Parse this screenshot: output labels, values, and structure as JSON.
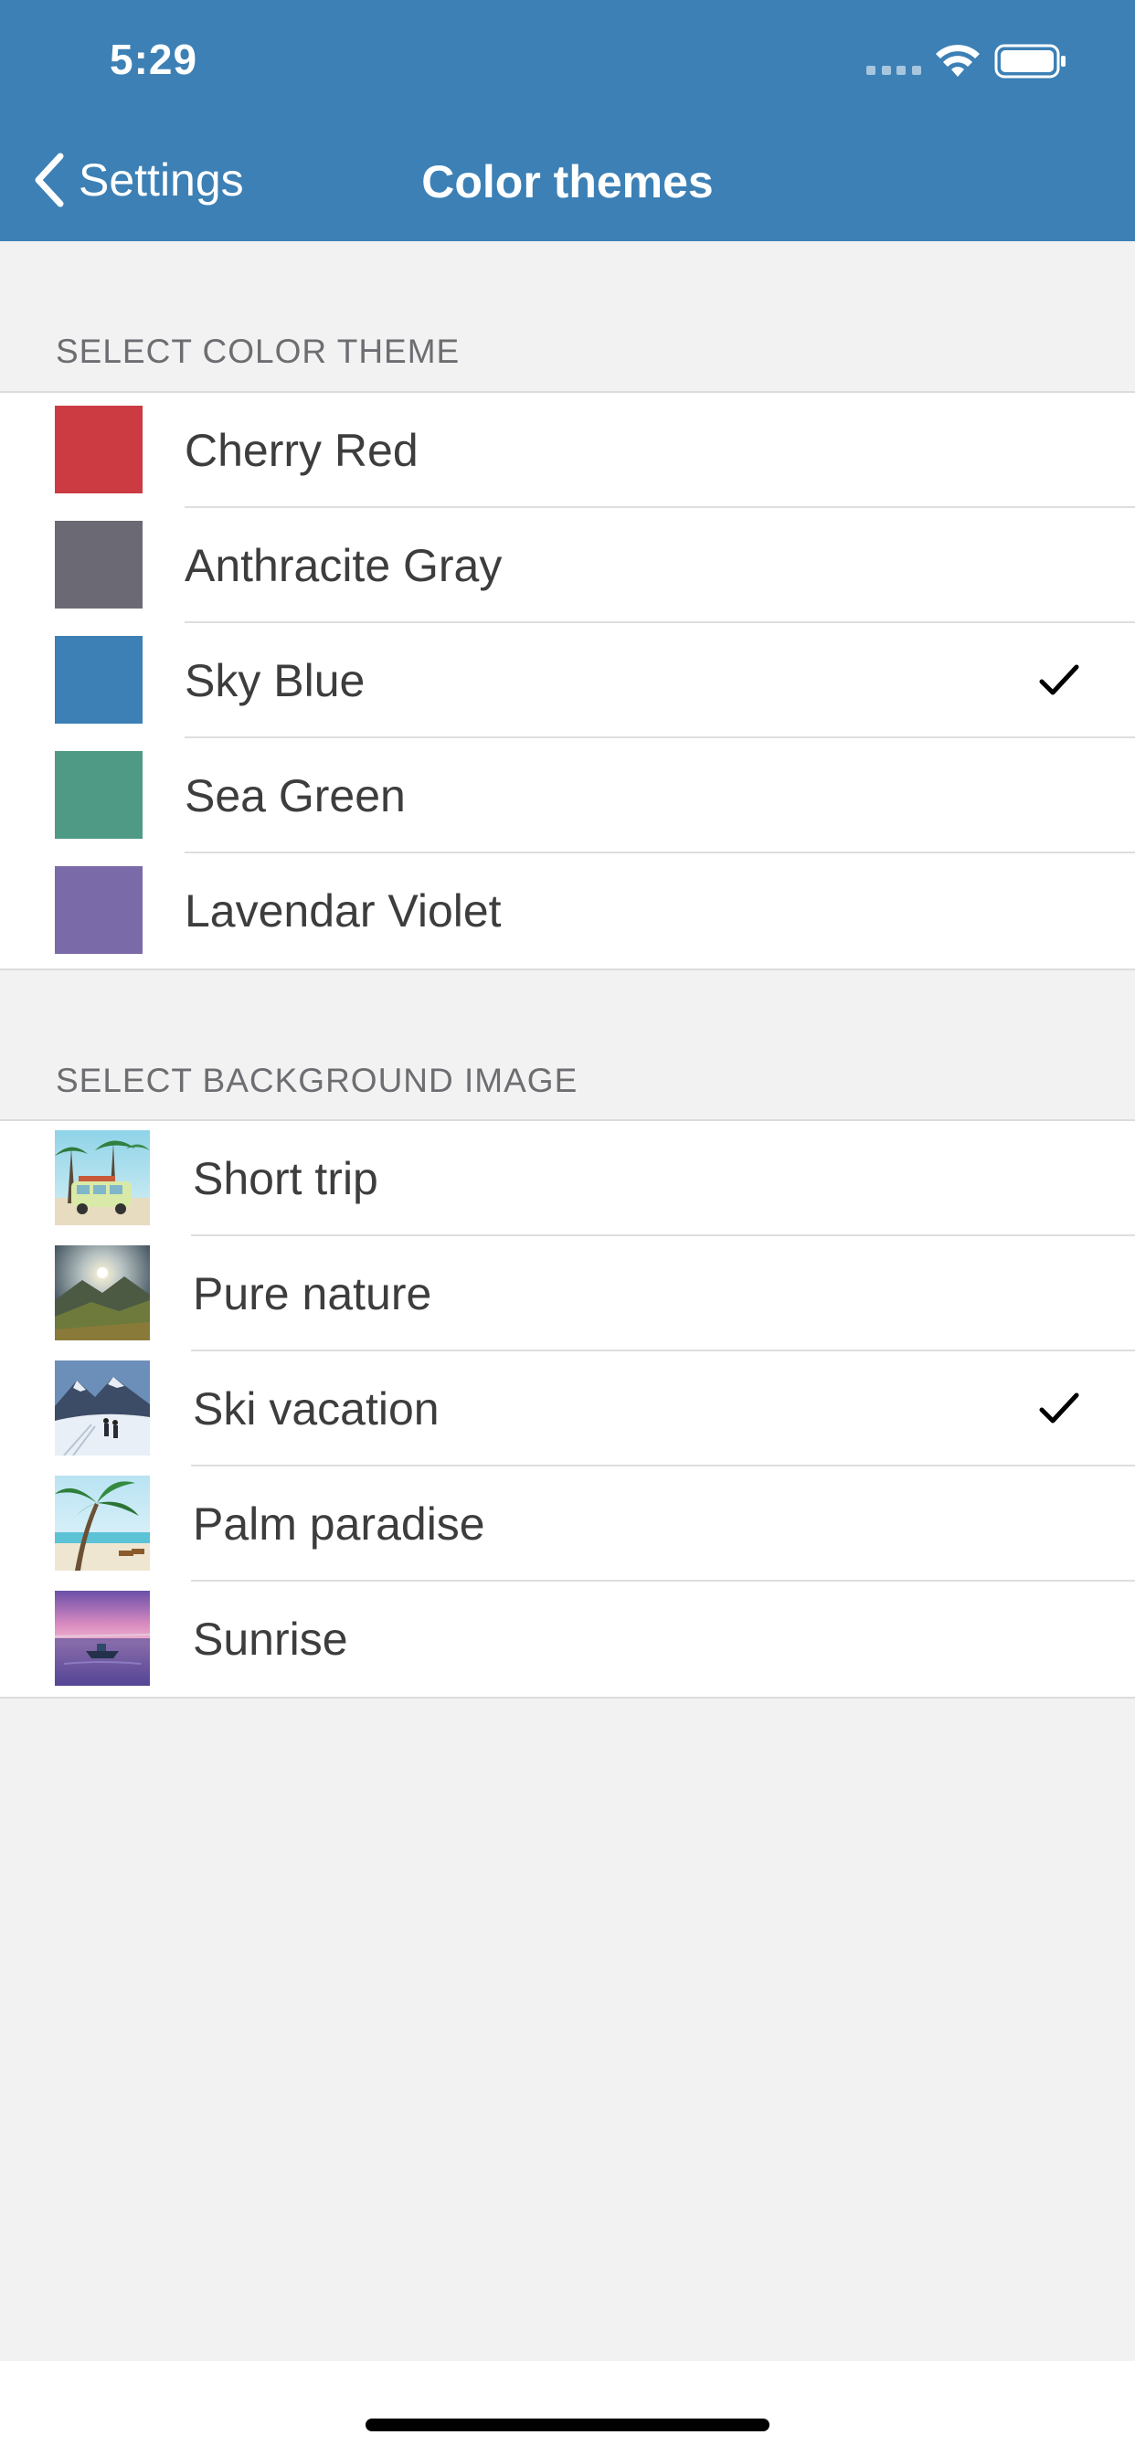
{
  "status_bar": {
    "time": "5:29"
  },
  "nav": {
    "back_label": "Settings",
    "title": "Color themes",
    "color": "#3c80b5"
  },
  "color_theme_section": {
    "header": "SELECT COLOR THEME",
    "items": [
      {
        "label": "Cherry Red",
        "color": "#cc3a42",
        "selected": false
      },
      {
        "label": "Anthracite Gray",
        "color": "#6b6a74",
        "selected": false
      },
      {
        "label": "Sky Blue",
        "color": "#3c80b5",
        "selected": true
      },
      {
        "label": "Sea Green",
        "color": "#4e9a84",
        "selected": false
      },
      {
        "label": "Lavendar Violet",
        "color": "#7b6aa8",
        "selected": false
      }
    ]
  },
  "background_image_section": {
    "header": "SELECT BACKGROUND IMAGE",
    "items": [
      {
        "label": "Short trip",
        "icon": "van-beach-thumbnail",
        "selected": false
      },
      {
        "label": "Pure nature",
        "icon": "mountain-sunset-thumbnail",
        "selected": false
      },
      {
        "label": "Ski vacation",
        "icon": "ski-mountain-thumbnail",
        "selected": true
      },
      {
        "label": "Palm paradise",
        "icon": "palm-beach-thumbnail",
        "selected": false
      },
      {
        "label": "Sunrise",
        "icon": "boat-sunrise-thumbnail",
        "selected": false
      }
    ]
  }
}
